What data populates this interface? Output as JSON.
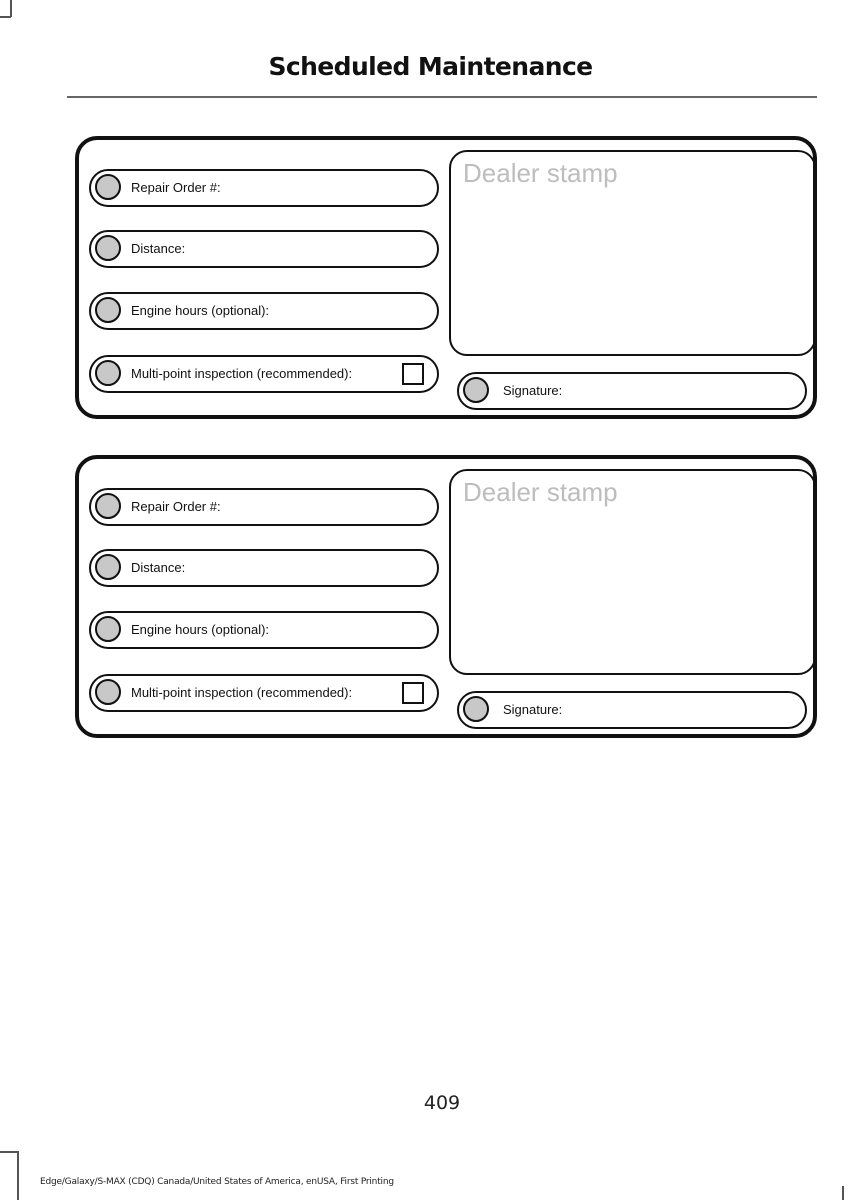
{
  "header": {
    "title": "Scheduled Maintenance"
  },
  "cards": [
    {
      "fields": [
        {
          "label": "Repair Order #:"
        },
        {
          "label": "Distance:"
        },
        {
          "label": "Engine hours (optional):"
        },
        {
          "label": "Multi-point inspection (recommended):",
          "checked": false
        }
      ],
      "stamp_label": "Dealer stamp",
      "signature_label": "Signature:"
    },
    {
      "fields": [
        {
          "label": "Repair Order #:"
        },
        {
          "label": "Distance:"
        },
        {
          "label": "Engine hours (optional):"
        },
        {
          "label": "Multi-point inspection (recommended):",
          "checked": false
        }
      ],
      "stamp_label": "Dealer stamp",
      "signature_label": "Signature:"
    }
  ],
  "footer": {
    "page_number": "409",
    "edition": "Edge/Galaxy/S-MAX (CDQ) Canada/United States of America, enUSA, First Printing"
  }
}
